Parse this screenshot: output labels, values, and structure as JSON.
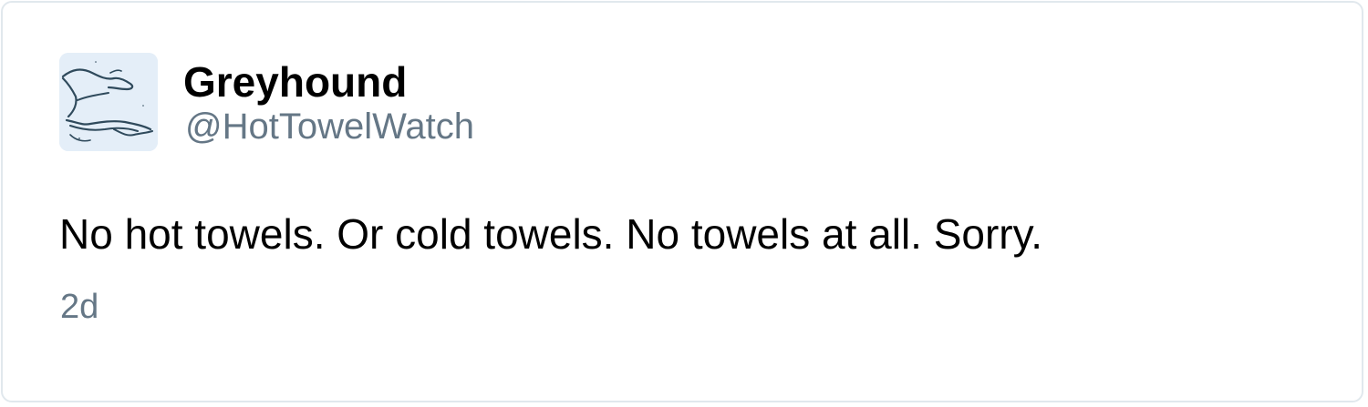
{
  "tweet": {
    "display_name": "Greyhound",
    "handle": "@HotTowelWatch",
    "text": "No hot towels. Or cold towels. No towels at all. Sorry.",
    "timestamp": "2d"
  },
  "avatar": {
    "icon": "greyhound-logo-icon",
    "background_color": "#e4eef8",
    "line_color": "#2f4a5c"
  },
  "colors": {
    "border": "#e1e8ed",
    "secondary_text": "#657786",
    "primary_text": "#000000"
  }
}
